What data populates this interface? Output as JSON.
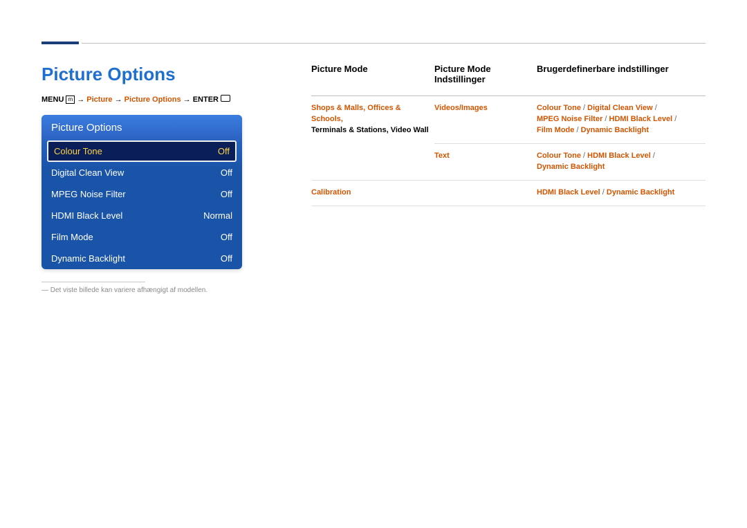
{
  "section_title": "Picture Options",
  "breadcrumb": {
    "menu": "MENU",
    "lvl1": "Picture",
    "lvl2": "Picture Options",
    "enter": "ENTER",
    "arrow": "→"
  },
  "osd": {
    "header": "Picture Options",
    "rows": [
      {
        "label": "Colour Tone",
        "value": "Off",
        "selected": true
      },
      {
        "label": "Digital Clean View",
        "value": "Off",
        "selected": false
      },
      {
        "label": "MPEG Noise Filter",
        "value": "Off",
        "selected": false
      },
      {
        "label": "HDMI Black Level",
        "value": "Normal",
        "selected": false
      },
      {
        "label": "Film Mode",
        "value": "Off",
        "selected": false
      },
      {
        "label": "Dynamic Backlight",
        "value": "Off",
        "selected": false
      }
    ]
  },
  "footnote": "―  Det viste billede kan variere afhængigt af modellen.",
  "table": {
    "headers": {
      "col1": "Picture Mode",
      "col2_l1": "Picture Mode",
      "col2_l2": "Indstillinger",
      "col3": "Brugerdefinerbare indstillinger"
    },
    "rows": [
      {
        "mode_l1": "Shops & Malls, Offices & Schools,",
        "mode_l2": "Terminals & Stations, Video Wall",
        "setting": "Videos/Images",
        "opts": [
          "Colour Tone",
          "Digital Clean View",
          "MPEG Noise Filter",
          "HDMI Black Level",
          "Film Mode",
          "Dynamic Backlight"
        ]
      },
      {
        "mode_l1": "",
        "mode_l2": "",
        "setting": "Text",
        "opts": [
          "Colour Tone",
          "HDMI Black Level",
          "Dynamic Backlight"
        ]
      },
      {
        "mode_l1": "Calibration",
        "mode_l2": "",
        "setting": "",
        "opts": [
          "HDMI Black Level",
          "Dynamic Backlight"
        ]
      }
    ]
  }
}
